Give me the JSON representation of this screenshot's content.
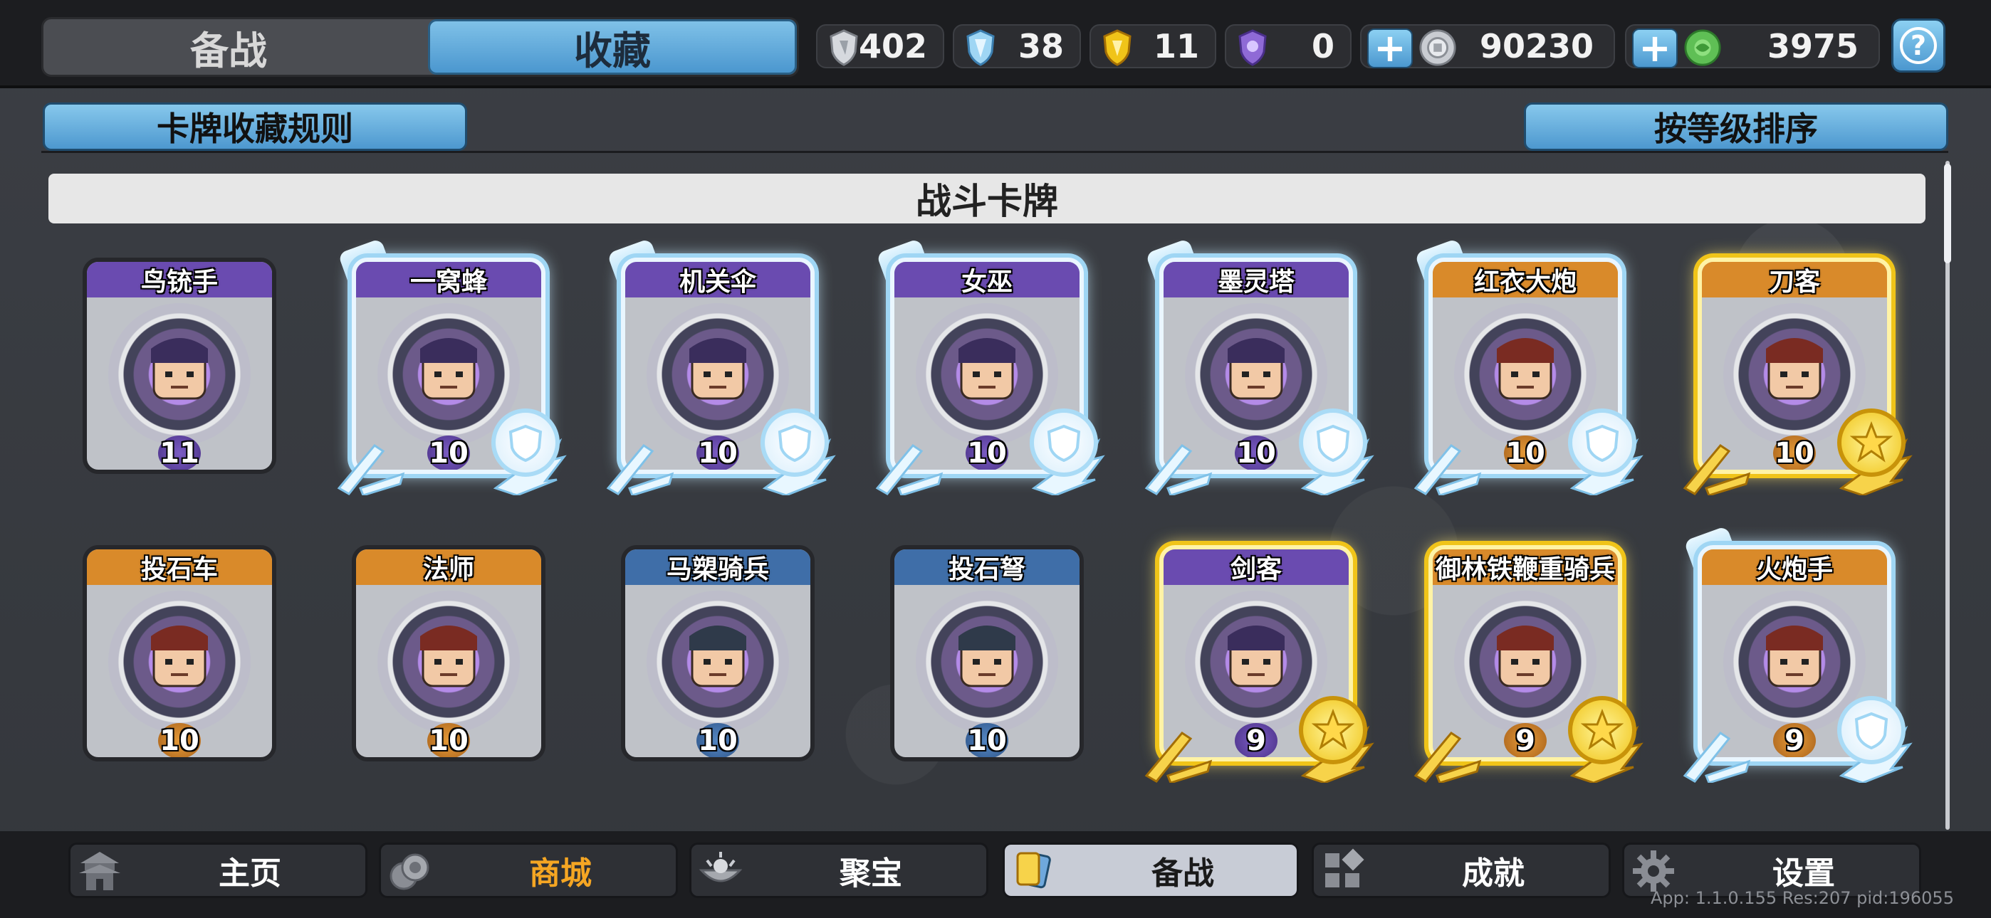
{
  "tabs": {
    "prep": "备战",
    "collection": "收藏"
  },
  "currencies": {
    "silver_tokens": "402",
    "crystal_tokens": "38",
    "gold_tokens": "11",
    "purple_tokens": "0",
    "coins": "90230",
    "gems": "3975"
  },
  "toolbar": {
    "rules_label": "卡牌收藏规则",
    "sort_label": "按等级排序"
  },
  "section": {
    "title": "战斗卡牌"
  },
  "cards": [
    {
      "name": "鸟铳手",
      "level": "11",
      "color": "purple",
      "tier": "plain"
    },
    {
      "name": "一窝蜂",
      "level": "10",
      "color": "purple",
      "tier": "silver"
    },
    {
      "name": "机关伞",
      "level": "10",
      "color": "purple",
      "tier": "silver"
    },
    {
      "name": "女巫",
      "level": "10",
      "color": "purple",
      "tier": "silver"
    },
    {
      "name": "墨灵塔",
      "level": "10",
      "color": "purple",
      "tier": "silver"
    },
    {
      "name": "红衣大炮",
      "level": "10",
      "color": "orange",
      "tier": "silver"
    },
    {
      "name": "刀客",
      "level": "10",
      "color": "orange",
      "tier": "gold"
    },
    {
      "name": "投石车",
      "level": "10",
      "color": "orange",
      "tier": "plain"
    },
    {
      "name": "法师",
      "level": "10",
      "color": "orange",
      "tier": "plain"
    },
    {
      "name": "马槊骑兵",
      "level": "10",
      "color": "blue",
      "tier": "plain"
    },
    {
      "name": "投石弩",
      "level": "10",
      "color": "blue",
      "tier": "plain"
    },
    {
      "name": "剑客",
      "level": "9",
      "color": "purple",
      "tier": "gold"
    },
    {
      "name": "御林铁鞭重骑兵",
      "level": "9",
      "color": "orange",
      "tier": "gold"
    },
    {
      "name": "火炮手",
      "level": "9",
      "color": "orange",
      "tier": "silver"
    }
  ],
  "nav": {
    "home": "主页",
    "shop": "商城",
    "treasure": "聚宝",
    "prep": "备战",
    "achievements": "成就",
    "settings": "设置"
  },
  "version": "App: 1.1.0.155 Res:207 pid:196055",
  "colors": {
    "accent_blue": "#4b97cf",
    "purple_banner": "#6a4bb0",
    "orange_banner": "#d98a2a",
    "blue_banner": "#3f6ea8",
    "gold": "#f0c419",
    "shop_text": "#f5a623"
  }
}
